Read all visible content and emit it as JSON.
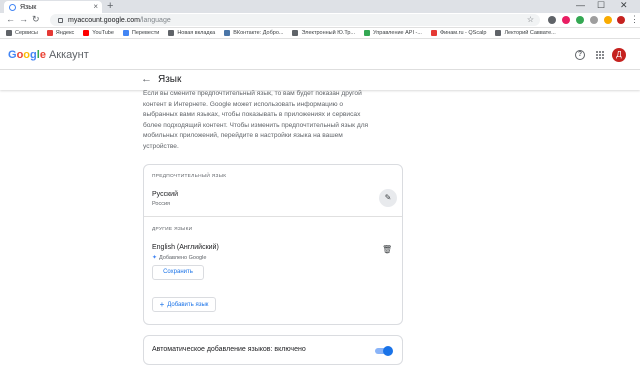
{
  "browser": {
    "tab_title": "Язык",
    "tab_close": "×",
    "new_tab": "+",
    "url_host": "myaccount.google.com",
    "url_path": "/language",
    "window_controls": [
      "—",
      "☐",
      "✕"
    ]
  },
  "bookmarks": [
    {
      "label": "Сервисы",
      "color": "#5f6368"
    },
    {
      "label": "Яндекс",
      "color": "#e53935"
    },
    {
      "label": "YouTube",
      "color": "#ff0000"
    },
    {
      "label": "Перевести",
      "color": "#4285f4"
    },
    {
      "label": "Новая вкладка",
      "color": "#5f6368"
    },
    {
      "label": "ВКонтакте: Добро...",
      "color": "#4a76a8"
    },
    {
      "label": "Электронный Ю.Тр...",
      "color": "#5f6368"
    },
    {
      "label": "Управление API -...",
      "color": "#34a853"
    },
    {
      "label": "Финам.ru - QScalp",
      "color": "#e53935"
    },
    {
      "label": "Лекторий Саввате...",
      "color": "#5f6368"
    }
  ],
  "header": {
    "logo_letters": [
      {
        "ch": "G",
        "color": "#4285f4"
      },
      {
        "ch": "o",
        "color": "#ea4335"
      },
      {
        "ch": "o",
        "color": "#fbbc05"
      },
      {
        "ch": "g",
        "color": "#4285f4"
      },
      {
        "ch": "l",
        "color": "#34a853"
      },
      {
        "ch": "e",
        "color": "#ea4335"
      }
    ],
    "logo_suffix": "Аккаунт",
    "help_icon": "?",
    "avatar_letter": "Д"
  },
  "page": {
    "back_arrow": "←",
    "title": "Язык",
    "description": "Если вы смените предпочтительный язык, то вам будет показан другой контент в Интернете. Google может использовать информацию о выбранных вами языках, чтобы показывать в приложениях и сервисах более подходящий контент. Чтобы изменить предпочтительный язык для мобильных приложений, перейдите в настройки языка на вашем устройстве."
  },
  "languages": {
    "preferred_header": "ПРЕДПОЧТИТЕЛЬНЫЙ ЯЗЫК",
    "preferred_name": "Русский",
    "preferred_region": "Россия",
    "edit_icon": "✎",
    "other_header": "ДРУГИЕ ЯЗЫКИ",
    "other_name": "English (Английский)",
    "other_added": "Добавлено Google",
    "trash_icon": "🗑",
    "save_label": "Сохранить",
    "add_label": "Добавить язык",
    "add_icon": "+"
  },
  "auto_add": {
    "label": "Автоматическое добавление языков: включено",
    "enabled": true
  }
}
